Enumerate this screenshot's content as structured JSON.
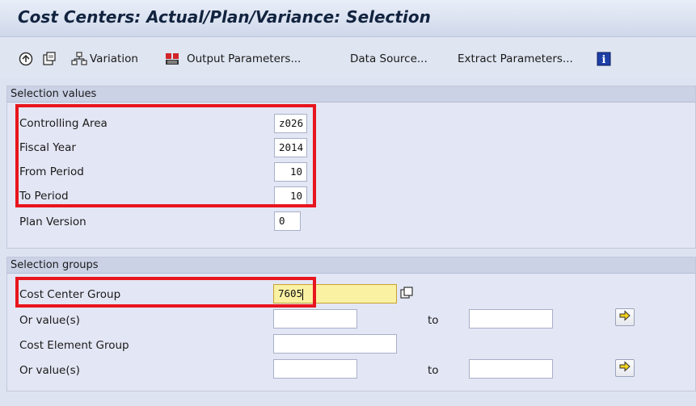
{
  "title": "Cost Centers: Actual/Plan/Variance: Selection",
  "toolbar": {
    "variation_label": "Variation",
    "output_parameters_label": "Output Parameters...",
    "data_source_label": "Data Source...",
    "extract_parameters_label": "Extract Parameters..."
  },
  "selection_values": {
    "heading": "Selection values",
    "controlling_area_label": "Controlling Area",
    "controlling_area_value": "z026",
    "fiscal_year_label": "Fiscal Year",
    "fiscal_year_value": "2014",
    "from_period_label": "From Period",
    "from_period_value": "10",
    "to_period_label": "To Period",
    "to_period_value": "10",
    "plan_version_label": "Plan Version",
    "plan_version_value": "0"
  },
  "selection_groups": {
    "heading": "Selection groups",
    "cost_center_group_label": "Cost Center Group",
    "cost_center_group_value": "7605",
    "or_values_label_1": "Or value(s)",
    "to_label_1": "to",
    "cost_element_group_label": "Cost Element Group",
    "or_values_label_2": "Or value(s)",
    "to_label_2": "to"
  },
  "colors": {
    "highlight": "#e8151e",
    "background": "#dde3f0",
    "active_field": "#fbf1a3"
  },
  "icons": [
    "execute-icon",
    "save-variant-icon",
    "variation-icon",
    "output-parameters-icon",
    "info-icon",
    "multiple-selection-icon",
    "arrow-right-icon"
  ]
}
